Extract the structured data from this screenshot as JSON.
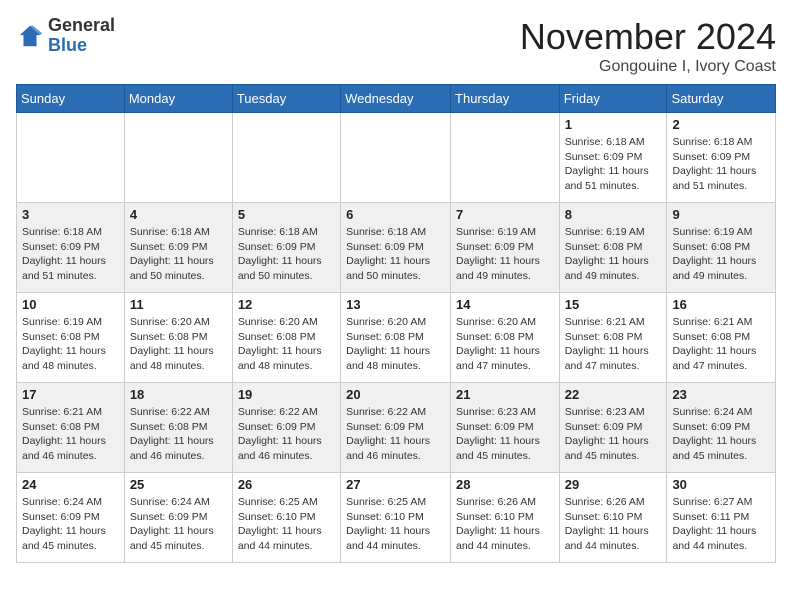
{
  "header": {
    "logo_general": "General",
    "logo_blue": "Blue",
    "month_title": "November 2024",
    "location": "Gongouine I, Ivory Coast"
  },
  "weekdays": [
    "Sunday",
    "Monday",
    "Tuesday",
    "Wednesday",
    "Thursday",
    "Friday",
    "Saturday"
  ],
  "weeks": [
    [
      {
        "day": "",
        "info": ""
      },
      {
        "day": "",
        "info": ""
      },
      {
        "day": "",
        "info": ""
      },
      {
        "day": "",
        "info": ""
      },
      {
        "day": "",
        "info": ""
      },
      {
        "day": "1",
        "info": "Sunrise: 6:18 AM\nSunset: 6:09 PM\nDaylight: 11 hours and 51 minutes."
      },
      {
        "day": "2",
        "info": "Sunrise: 6:18 AM\nSunset: 6:09 PM\nDaylight: 11 hours and 51 minutes."
      }
    ],
    [
      {
        "day": "3",
        "info": "Sunrise: 6:18 AM\nSunset: 6:09 PM\nDaylight: 11 hours and 51 minutes."
      },
      {
        "day": "4",
        "info": "Sunrise: 6:18 AM\nSunset: 6:09 PM\nDaylight: 11 hours and 50 minutes."
      },
      {
        "day": "5",
        "info": "Sunrise: 6:18 AM\nSunset: 6:09 PM\nDaylight: 11 hours and 50 minutes."
      },
      {
        "day": "6",
        "info": "Sunrise: 6:18 AM\nSunset: 6:09 PM\nDaylight: 11 hours and 50 minutes."
      },
      {
        "day": "7",
        "info": "Sunrise: 6:19 AM\nSunset: 6:09 PM\nDaylight: 11 hours and 49 minutes."
      },
      {
        "day": "8",
        "info": "Sunrise: 6:19 AM\nSunset: 6:08 PM\nDaylight: 11 hours and 49 minutes."
      },
      {
        "day": "9",
        "info": "Sunrise: 6:19 AM\nSunset: 6:08 PM\nDaylight: 11 hours and 49 minutes."
      }
    ],
    [
      {
        "day": "10",
        "info": "Sunrise: 6:19 AM\nSunset: 6:08 PM\nDaylight: 11 hours and 48 minutes."
      },
      {
        "day": "11",
        "info": "Sunrise: 6:20 AM\nSunset: 6:08 PM\nDaylight: 11 hours and 48 minutes."
      },
      {
        "day": "12",
        "info": "Sunrise: 6:20 AM\nSunset: 6:08 PM\nDaylight: 11 hours and 48 minutes."
      },
      {
        "day": "13",
        "info": "Sunrise: 6:20 AM\nSunset: 6:08 PM\nDaylight: 11 hours and 48 minutes."
      },
      {
        "day": "14",
        "info": "Sunrise: 6:20 AM\nSunset: 6:08 PM\nDaylight: 11 hours and 47 minutes."
      },
      {
        "day": "15",
        "info": "Sunrise: 6:21 AM\nSunset: 6:08 PM\nDaylight: 11 hours and 47 minutes."
      },
      {
        "day": "16",
        "info": "Sunrise: 6:21 AM\nSunset: 6:08 PM\nDaylight: 11 hours and 47 minutes."
      }
    ],
    [
      {
        "day": "17",
        "info": "Sunrise: 6:21 AM\nSunset: 6:08 PM\nDaylight: 11 hours and 46 minutes."
      },
      {
        "day": "18",
        "info": "Sunrise: 6:22 AM\nSunset: 6:08 PM\nDaylight: 11 hours and 46 minutes."
      },
      {
        "day": "19",
        "info": "Sunrise: 6:22 AM\nSunset: 6:09 PM\nDaylight: 11 hours and 46 minutes."
      },
      {
        "day": "20",
        "info": "Sunrise: 6:22 AM\nSunset: 6:09 PM\nDaylight: 11 hours and 46 minutes."
      },
      {
        "day": "21",
        "info": "Sunrise: 6:23 AM\nSunset: 6:09 PM\nDaylight: 11 hours and 45 minutes."
      },
      {
        "day": "22",
        "info": "Sunrise: 6:23 AM\nSunset: 6:09 PM\nDaylight: 11 hours and 45 minutes."
      },
      {
        "day": "23",
        "info": "Sunrise: 6:24 AM\nSunset: 6:09 PM\nDaylight: 11 hours and 45 minutes."
      }
    ],
    [
      {
        "day": "24",
        "info": "Sunrise: 6:24 AM\nSunset: 6:09 PM\nDaylight: 11 hours and 45 minutes."
      },
      {
        "day": "25",
        "info": "Sunrise: 6:24 AM\nSunset: 6:09 PM\nDaylight: 11 hours and 45 minutes."
      },
      {
        "day": "26",
        "info": "Sunrise: 6:25 AM\nSunset: 6:10 PM\nDaylight: 11 hours and 44 minutes."
      },
      {
        "day": "27",
        "info": "Sunrise: 6:25 AM\nSunset: 6:10 PM\nDaylight: 11 hours and 44 minutes."
      },
      {
        "day": "28",
        "info": "Sunrise: 6:26 AM\nSunset: 6:10 PM\nDaylight: 11 hours and 44 minutes."
      },
      {
        "day": "29",
        "info": "Sunrise: 6:26 AM\nSunset: 6:10 PM\nDaylight: 11 hours and 44 minutes."
      },
      {
        "day": "30",
        "info": "Sunrise: 6:27 AM\nSunset: 6:11 PM\nDaylight: 11 hours and 44 minutes."
      }
    ]
  ]
}
